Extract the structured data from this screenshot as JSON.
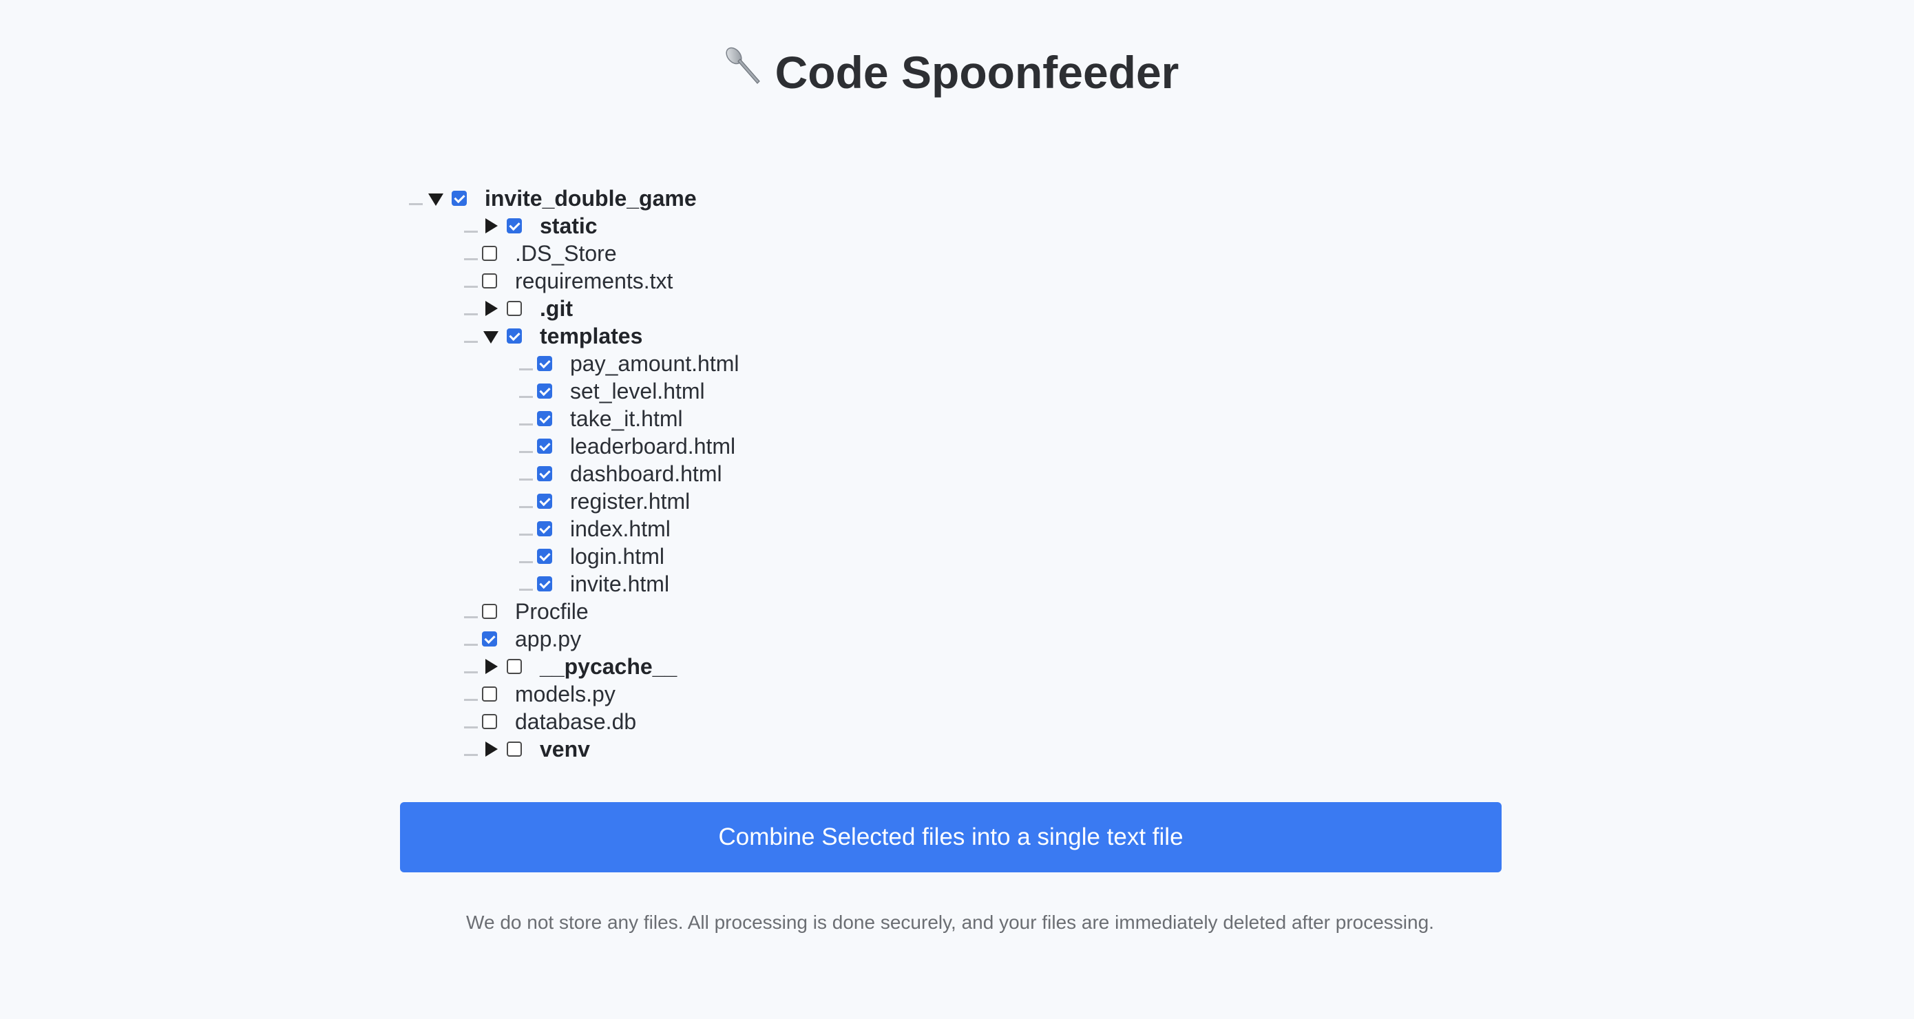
{
  "app": {
    "title": "Code Spoonfeeder",
    "title_icon": "spoon-icon"
  },
  "tree": {
    "root": {
      "label": "invite_double_game",
      "checked": true,
      "expanded": true
    },
    "items": [
      {
        "label": "static",
        "type": "folder",
        "checked": true,
        "expanded": false
      },
      {
        "label": ".DS_Store",
        "type": "file",
        "checked": false
      },
      {
        "label": "requirements.txt",
        "type": "file",
        "checked": false
      },
      {
        "label": ".git",
        "type": "folder",
        "checked": false,
        "expanded": false
      },
      {
        "label": "templates",
        "type": "folder",
        "checked": true,
        "expanded": true
      },
      {
        "label": "pay_amount.html",
        "type": "file",
        "checked": true
      },
      {
        "label": "set_level.html",
        "type": "file",
        "checked": true
      },
      {
        "label": "take_it.html",
        "type": "file",
        "checked": true
      },
      {
        "label": "leaderboard.html",
        "type": "file",
        "checked": true
      },
      {
        "label": "dashboard.html",
        "type": "file",
        "checked": true
      },
      {
        "label": "register.html",
        "type": "file",
        "checked": true
      },
      {
        "label": "index.html",
        "type": "file",
        "checked": true
      },
      {
        "label": "login.html",
        "type": "file",
        "checked": true
      },
      {
        "label": "invite.html",
        "type": "file",
        "checked": true
      },
      {
        "label": "Procfile",
        "type": "file",
        "checked": false
      },
      {
        "label": "app.py",
        "type": "file",
        "checked": true
      },
      {
        "label": "__pycache__",
        "type": "folder",
        "checked": false,
        "expanded": false
      },
      {
        "label": "models.py",
        "type": "file",
        "checked": false
      },
      {
        "label": "database.db",
        "type": "file",
        "checked": false
      },
      {
        "label": "venv",
        "type": "folder",
        "checked": false,
        "expanded": false
      }
    ]
  },
  "actions": {
    "combine_label": "Combine Selected files into a single text file"
  },
  "footer": {
    "note": "We do not store any files. All processing is done securely, and your files are immediately deleted after processing."
  },
  "colors": {
    "accent": "#3a7af2",
    "checkbox": "#2f6fe4",
    "background": "#f7f9fc"
  }
}
